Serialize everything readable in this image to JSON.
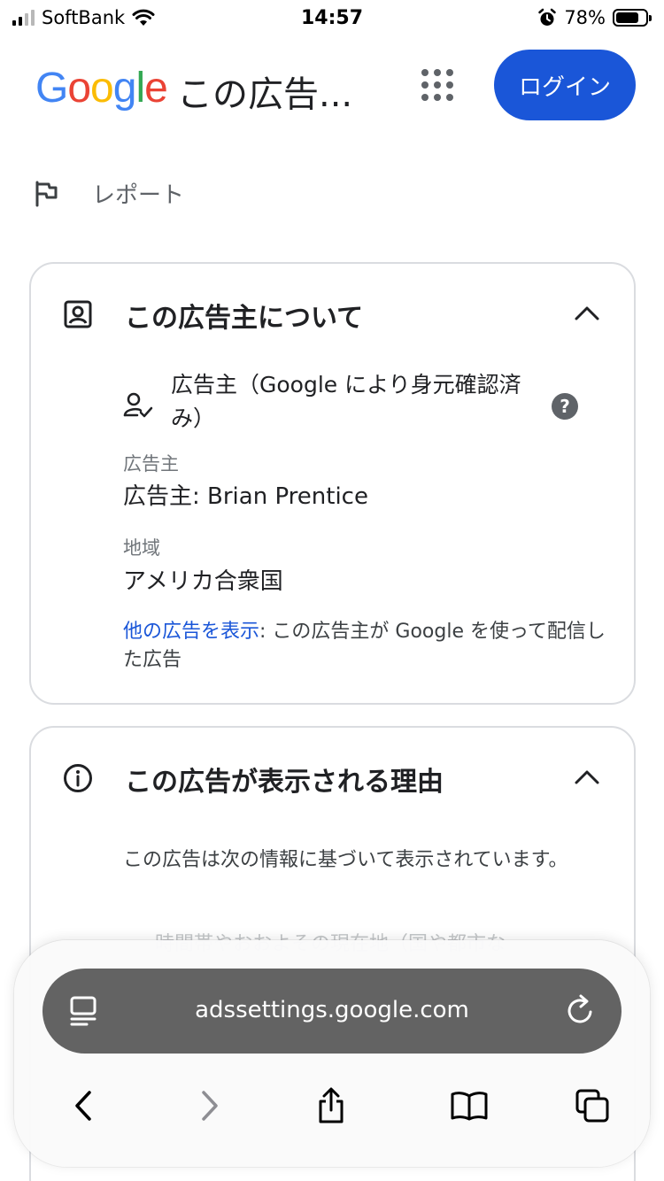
{
  "status_bar": {
    "carrier": "SoftBank",
    "time": "14:57",
    "battery_percent": "78%",
    "battery_level": 0.78
  },
  "header": {
    "logo_letters": [
      {
        "char": "G",
        "color": "#4285F4"
      },
      {
        "char": "o",
        "color": "#EA4335"
      },
      {
        "char": "o",
        "color": "#FBBC05"
      },
      {
        "char": "g",
        "color": "#4285F4"
      },
      {
        "char": "l",
        "color": "#34A853"
      },
      {
        "char": "e",
        "color": "#EA4335"
      }
    ],
    "title": "この広告...",
    "apps_icon": "apps-grid-icon",
    "login_label": "ログイン"
  },
  "report": {
    "icon": "flag-icon",
    "label": "レポート"
  },
  "advertiser_card": {
    "icon": "account-box-icon",
    "title": "この広告主について",
    "verified_icon": "person-check-icon",
    "verified_text": "広告主（Google により身元確認済み）",
    "help_label": "?",
    "advertiser_label": "広告主",
    "advertiser_value": "広告主: Brian Prentice",
    "region_label": "地域",
    "region_value": "アメリカ合衆国",
    "more_ads_link": "他の広告を表示",
    "more_ads_text": ": この広告主が Google を使って配信した広告"
  },
  "reason_card": {
    "icon": "info-icon",
    "title": "この広告が表示される理由",
    "intro": "この広告は次の情報に基づいて表示されています。",
    "faded_text": "時間帯やおおよその現在地（国や都市な"
  },
  "browser": {
    "url": "adssettings.google.com",
    "nav_icons": [
      "back-icon",
      "forward-icon",
      "share-icon",
      "bookmarks-icon",
      "tabs-icon"
    ]
  },
  "colors": {
    "accent": "#1a56d8",
    "address_bar": "#636363",
    "icon_gray": "#5f6368"
  }
}
